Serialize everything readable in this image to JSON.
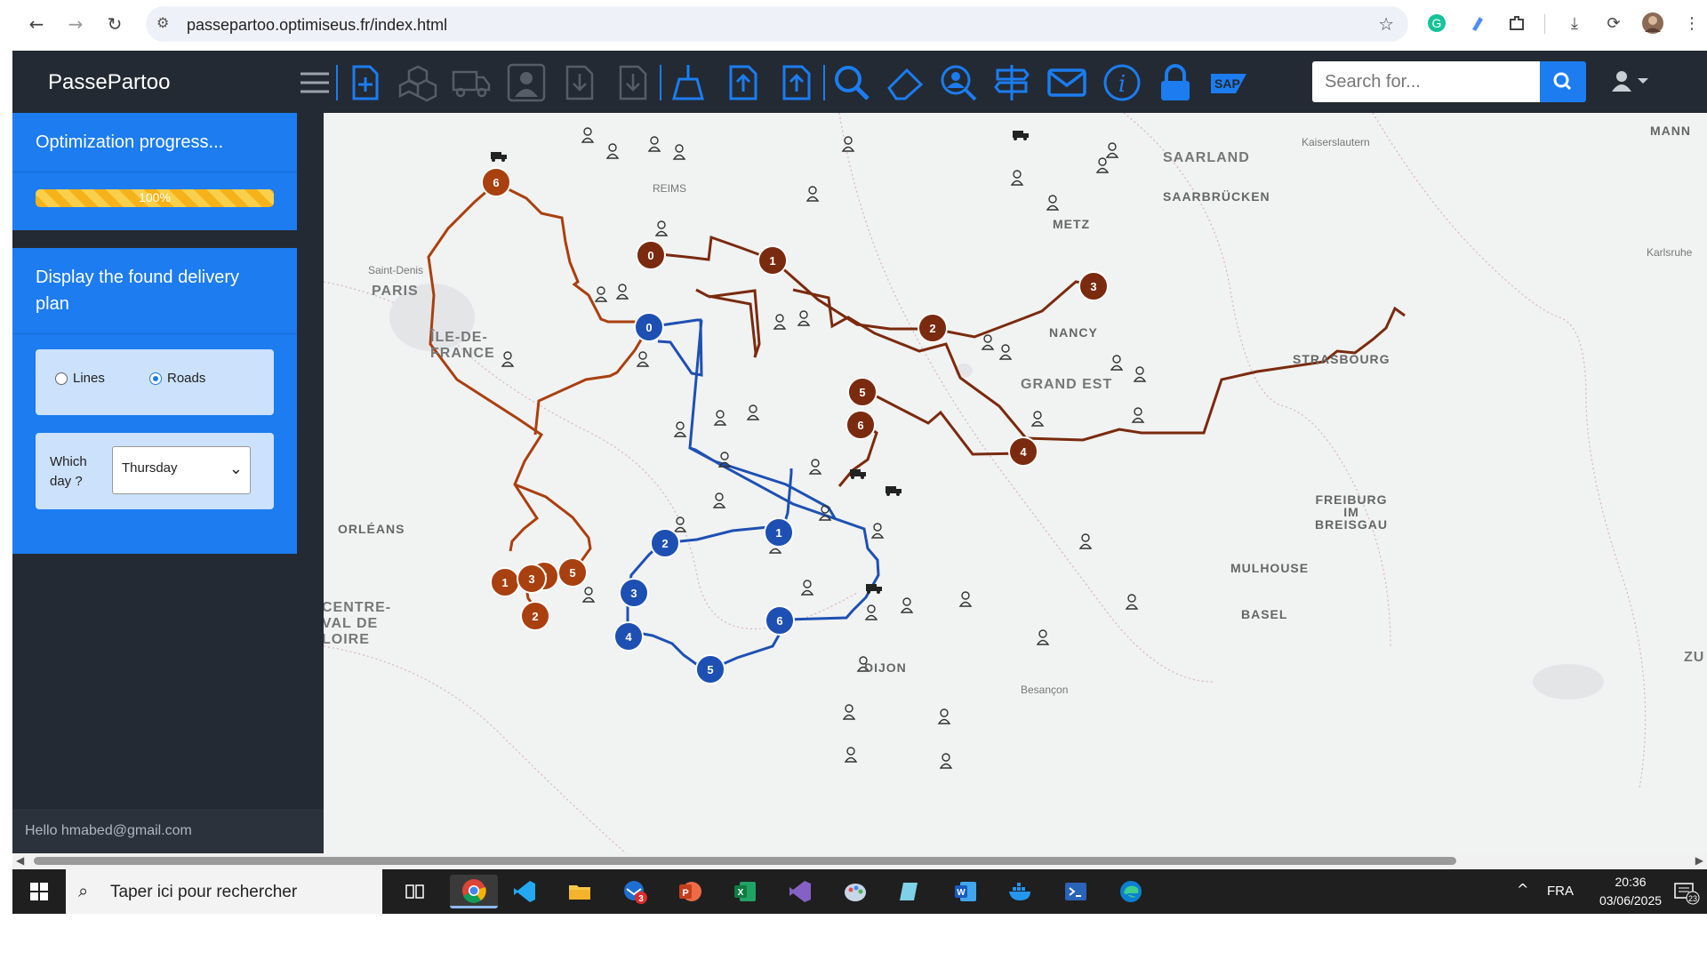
{
  "browser": {
    "url": "passepartoo.optimiseus.fr/index.html",
    "icons": [
      "back-icon",
      "forward-icon",
      "reload-icon",
      "site-info-icon",
      "star-icon",
      "grammarly-icon",
      "extension-pen-icon",
      "extensions-puzzle-icon",
      "download-icon",
      "performance-icon",
      "profile-avatar"
    ]
  },
  "app": {
    "brand": "PassePartoo",
    "toolbar_icons": [
      "hamburger-menu-icon",
      "add-document-icon",
      "boxes-icon",
      "truck-icon",
      "person-card-icon",
      "import-file-icon",
      "export-file-icon",
      "broom-icon",
      "upload-file-icon",
      "upload-file-2-icon",
      "search-icon",
      "eraser-icon",
      "zoom-person-icon",
      "signpost-icon",
      "envelope-icon",
      "info-icon",
      "lock-icon",
      "sap-icon"
    ],
    "search": {
      "placeholder": "Search for..."
    },
    "accent": "#1c7cf0",
    "dark": "#232a33"
  },
  "sidebar": {
    "progress_title": "Optimization progress...",
    "progress_value": 100,
    "progress_label": "100%",
    "display_title": "Display the found delivery plan",
    "display_mode_options": [
      "Lines",
      "Roads"
    ],
    "display_mode_selected": "Roads",
    "day_label": "Which day ?",
    "day_selected": "Thursday",
    "hello": "Hello hmabed@gmail.com"
  },
  "map": {
    "cities": [
      "REIMS",
      "PARIS",
      "Saint-Denis",
      "ÎLE-DE-FRANCE",
      "ORLÉANS",
      "CENTRE-VAL DE LOIRE",
      "METZ",
      "NANCY",
      "GRAND EST",
      "STRASBOURG",
      "SAARLAND",
      "SAARBRÜCKEN",
      "Kaiserslautern",
      "Karlsruhe",
      "MANN",
      "FREIBURG IM BREISGAU",
      "MULHOUSE",
      "BASEL",
      "DIJON",
      "Besançon",
      "ZU"
    ],
    "routes": [
      {
        "color": "#7a2a0e",
        "stops": [
          "0",
          "1",
          "2",
          "3",
          "4",
          "5",
          "6"
        ]
      },
      {
        "color": "#a9400f",
        "stops": [
          "1",
          "2",
          "3",
          "4",
          "5",
          "6"
        ]
      },
      {
        "color": "#1e50b3",
        "stops": [
          "0",
          "1",
          "2",
          "3",
          "4",
          "5",
          "6"
        ]
      }
    ]
  },
  "taskbar": {
    "search_placeholder": "Taper ici pour rechercher",
    "apps": [
      "task-view",
      "chrome",
      "vscode",
      "file-explorer",
      "thunderbird",
      "powerpoint",
      "excel",
      "visual-studio",
      "paint",
      "notepad",
      "word",
      "docker",
      "terminal",
      "edge"
    ],
    "thunderbird_badge": "3",
    "lang": "FRA",
    "time": "20:36",
    "date": "03/06/2025",
    "notifications": "23"
  }
}
